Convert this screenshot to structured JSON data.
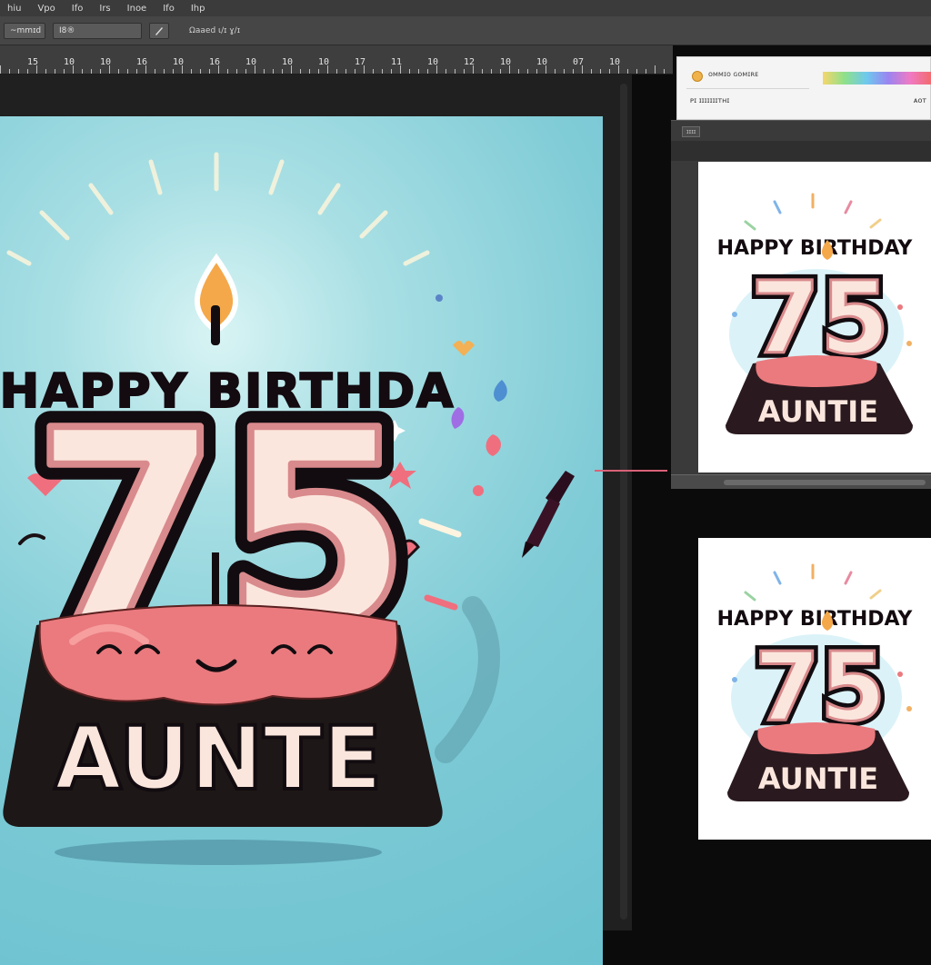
{
  "menu": [
    "hiu",
    "Ⅴpo",
    "Ⅰfo",
    "Ⅰrs",
    "Ⅰnoe",
    "Ⅰfo",
    "Ⅰhp"
  ],
  "options": {
    "tool_preset": "~mmɪd",
    "field_value": "Ⅰ8®",
    "mode_label": "Ωaaed  ɩ/ɪ ɣ/ɪ"
  },
  "ruler": [
    "15",
    "10",
    "10",
    "16",
    "10",
    "16",
    "10",
    "10",
    "10",
    "17",
    "11",
    "10",
    "12",
    "10",
    "10",
    "07",
    "10"
  ],
  "side": {
    "swatch_label": "ᴏᴍᴍɪᴏ ɢᴏᴍɪʀᴇ",
    "label_left": "ᴘɪ  ɪɪɪɪɪɪɪᴛʜɪ",
    "label_right": "ᴀᴏᴛ",
    "tab": "ɪɪɪɪ"
  },
  "artwork": {
    "main": {
      "headline": "HAPPY BIRTHDA",
      "number": "75",
      "name": "AUNTE"
    },
    "thumb1": {
      "headline": "HAPPY BIRTHDAY",
      "number": "75",
      "name": "AUNTIE"
    },
    "thumb2": {
      "headline": "HAPPY BIRTHDAY",
      "number": "75",
      "name": "AUNTIE"
    }
  },
  "colors": {
    "frosting": "#ea7a7e",
    "cake": "#1f1a1a",
    "cream": "#fbe6dd",
    "flame": "#f4a84a",
    "outline": "#120c10"
  }
}
